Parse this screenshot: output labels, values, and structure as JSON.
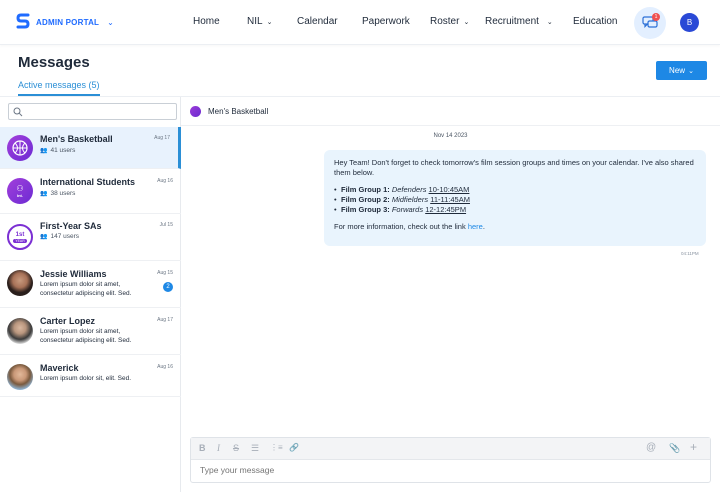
{
  "brand": {
    "label": "ADMIN PORTAL",
    "chevron": "⌄",
    "logo_icon": "brand-s-logo",
    "color": "#1f6bff"
  },
  "nav": {
    "items": [
      {
        "label": "Home",
        "has_dropdown": false
      },
      {
        "label": "NIL",
        "has_dropdown": true
      },
      {
        "label": "Calendar",
        "has_dropdown": false
      },
      {
        "label": "Paperwork",
        "has_dropdown": false
      },
      {
        "label": "Roster",
        "has_dropdown": true
      },
      {
        "label": "Recruitment",
        "has_dropdown": true
      },
      {
        "label": "Education",
        "has_dropdown": false
      }
    ],
    "dropdown_chevron": "⌄",
    "notifications_icon": "chat-bubbles-icon",
    "notification_count": "1",
    "user_initial": "B"
  },
  "page": {
    "title": "Messages",
    "active_tab": "Active messages (5)",
    "new_button": "New",
    "new_button_chevron": "⌄",
    "accent": "#1e88e5"
  },
  "search": {
    "placeholder": "",
    "icon": "search-icon"
  },
  "conversations": [
    {
      "name": "Men's Basketball",
      "date": "Aug 17",
      "sub": "41 users",
      "active": true
    },
    {
      "name": "International Students",
      "date": "Aug 16",
      "sub": "38 users",
      "avatar_text": "Int."
    },
    {
      "name": "First-Year SAs",
      "date": "Jul 15",
      "sub": "147 users",
      "avatar_text": "1st",
      "avatar_text2": "YEAR"
    },
    {
      "name": "Jessie Williams",
      "date": "Aug 15",
      "preview": "Lorem ipsum dolor sit amet, consectetur adipiscing elit. Sed.",
      "unread": "2"
    },
    {
      "name": "Carter Lopez",
      "date": "Aug 17",
      "preview": "Lorem ipsum dolor sit amet, consectetur adipiscing elit. Sed."
    },
    {
      "name": "Maverick",
      "date": "Aug 16",
      "preview": "Lorem ipsum dolor sit, elit. Sed."
    }
  ],
  "chat": {
    "title": "Men's Basketball",
    "date_separator": "Nov 14 2023",
    "message": {
      "intro": "Hey Team! Don't forget to check tomorrow's film session groups and times on your calendar. I've also shared them below.",
      "groups": [
        {
          "label": "Film Group 1:",
          "position": "Defenders",
          "time": "10-10:45AM"
        },
        {
          "label": "Film Group 2:",
          "position": "Midfielders",
          "time": "11-11:45AM"
        },
        {
          "label": "Film Group 3:",
          "position": "Forwards",
          "time": "12-12:45PM"
        }
      ],
      "outro_text": "For more information, check out the link",
      "outro_link": "here",
      "outro_end": ".",
      "time": "04:11PM"
    }
  },
  "composer": {
    "placeholder": "Type your message",
    "toolbar": {
      "bold": "B",
      "italic": "I",
      "strike": "S",
      "bullet": "☰",
      "numbered": "⋮≡",
      "link": "🔗",
      "mention": "@",
      "attach": "📎",
      "add": "+"
    }
  }
}
